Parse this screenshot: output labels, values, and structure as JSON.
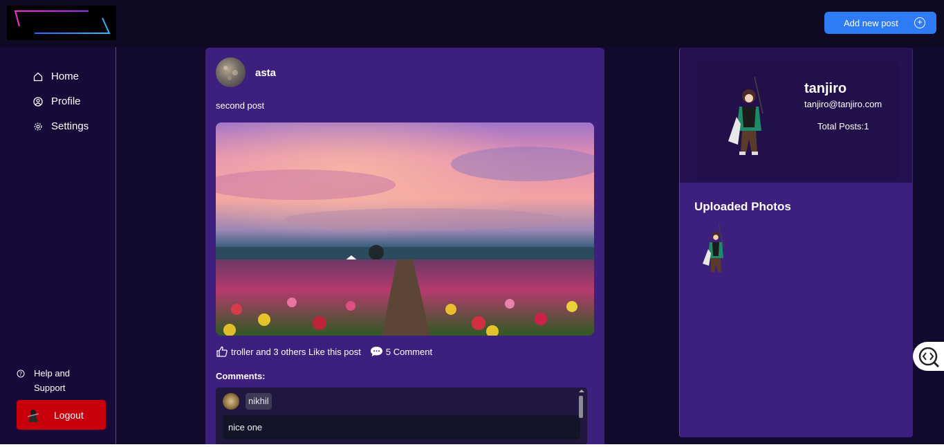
{
  "header": {
    "add_post_label": "Add new post"
  },
  "sidebar": {
    "items": [
      {
        "label": "Home",
        "icon": "home-icon"
      },
      {
        "label": "Profile",
        "icon": "user-circle-icon"
      },
      {
        "label": "Settings",
        "icon": "gear-icon"
      }
    ],
    "help_label": "Help and Support",
    "logout_label": "Logout"
  },
  "post": {
    "username": "asta",
    "text": "second post",
    "likes_text": "troller and 3 others Like this post",
    "comments_count_text": "5 Comment",
    "comments_title": "Comments:",
    "comments": [
      {
        "user": "nikhil",
        "text": "nice one"
      }
    ]
  },
  "profile": {
    "name": "tanjiro",
    "email": "tanjiro@tanjiro.com",
    "total_posts": "Total Posts:1",
    "uploaded_title": "Uploaded Photos"
  },
  "colors": {
    "accent_blue": "#2f7bf5",
    "logout_red": "#c8000c",
    "card_purple": "#3d1f7d",
    "page_bg": "#120a2e"
  }
}
